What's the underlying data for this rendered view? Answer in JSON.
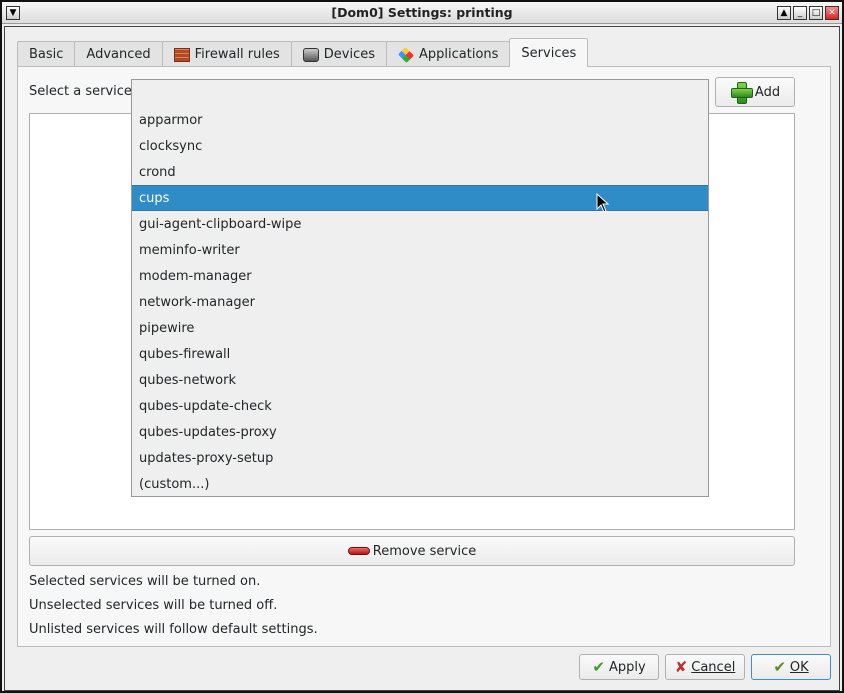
{
  "window": {
    "title": "[Dom0] Settings: printing",
    "controls": [
      "shade",
      "minimize",
      "maximize",
      "close"
    ]
  },
  "tabs": [
    {
      "label": "Basic",
      "icon": null,
      "active": false
    },
    {
      "label": "Advanced",
      "icon": null,
      "active": false
    },
    {
      "label": "Firewall rules",
      "icon": "firewall-brick-icon",
      "active": false
    },
    {
      "label": "Devices",
      "icon": "devices-icon",
      "active": false
    },
    {
      "label": "Applications",
      "icon": "applications-icon",
      "active": false
    },
    {
      "label": "Services",
      "icon": null,
      "active": true
    }
  ],
  "services": {
    "select_label": "Select a service:",
    "combo_value": "",
    "add_label": "Add",
    "dropdown_items": [
      "apparmor",
      "clocksync",
      "crond",
      "cups",
      "gui-agent-clipboard-wipe",
      "meminfo-writer",
      "modem-manager",
      "network-manager",
      "pipewire",
      "qubes-firewall",
      "qubes-network",
      "qubes-update-check",
      "qubes-updates-proxy",
      "updates-proxy-setup",
      "(custom...)"
    ],
    "highlighted_item": "cups",
    "remove_label": "Remove service",
    "info": [
      "Selected services will be turned on.",
      "Unselected services will be turned off.",
      "Unlisted services will follow default settings."
    ]
  },
  "footer": {
    "apply_label": "Apply",
    "cancel_label": "Cancel",
    "ok_label": "OK"
  },
  "colors": {
    "selection": "#308cc6",
    "background": "#efefef"
  }
}
